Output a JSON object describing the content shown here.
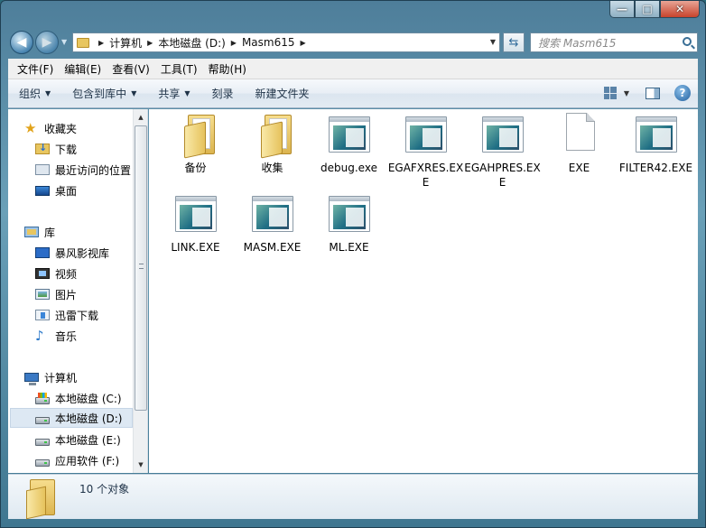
{
  "window": {
    "caption": {
      "minimize": "—",
      "maximize": "□",
      "close": "✕"
    }
  },
  "address": {
    "crumbs": [
      "计算机",
      "本地磁盘 (D:)",
      "Masm615"
    ],
    "search_placeholder": "搜索 Masm615"
  },
  "menu": [
    "文件(F)",
    "编辑(E)",
    "查看(V)",
    "工具(T)",
    "帮助(H)"
  ],
  "commands": {
    "organize": "组织",
    "include_library": "包含到库中",
    "share": "共享",
    "burn": "刻录",
    "new_folder": "新建文件夹",
    "help": "?"
  },
  "nav": {
    "favorites": "收藏夹",
    "downloads": "下载",
    "recent": "最近访问的位置",
    "desktop": "桌面",
    "libraries": "库",
    "storm": "暴风影视库",
    "videos": "视频",
    "pictures": "图片",
    "thunder": "迅雷下载",
    "music": "音乐",
    "computer": "计算机",
    "drive_c": "本地磁盘 (C:)",
    "drive_d": "本地磁盘 (D:)",
    "drive_e": "本地磁盘 (E:)",
    "drive_f": "应用软件 (F:)"
  },
  "files": [
    {
      "name": "备份",
      "icon": "folder-icon"
    },
    {
      "name": "收集",
      "icon": "folder-icon"
    },
    {
      "name": "debug.exe",
      "icon": "exe-icon"
    },
    {
      "name": "EGAFXRES.EXE",
      "icon": "exe-icon"
    },
    {
      "name": "EGAHPRES.EXE",
      "icon": "exe-icon"
    },
    {
      "name": "EXE",
      "icon": "blank-file-icon"
    },
    {
      "name": "FILTER42.EXE",
      "icon": "exe-icon"
    },
    {
      "name": "LINK.EXE",
      "icon": "exe-icon"
    },
    {
      "name": "MASM.EXE",
      "icon": "exe-icon"
    },
    {
      "name": "ML.EXE",
      "icon": "exe-icon"
    }
  ],
  "details": {
    "count_text": "10 个对象"
  },
  "colors": {
    "selection": "#dde8f3",
    "command_bar": "#dbe5ef",
    "accent": "#2f6b9a"
  }
}
